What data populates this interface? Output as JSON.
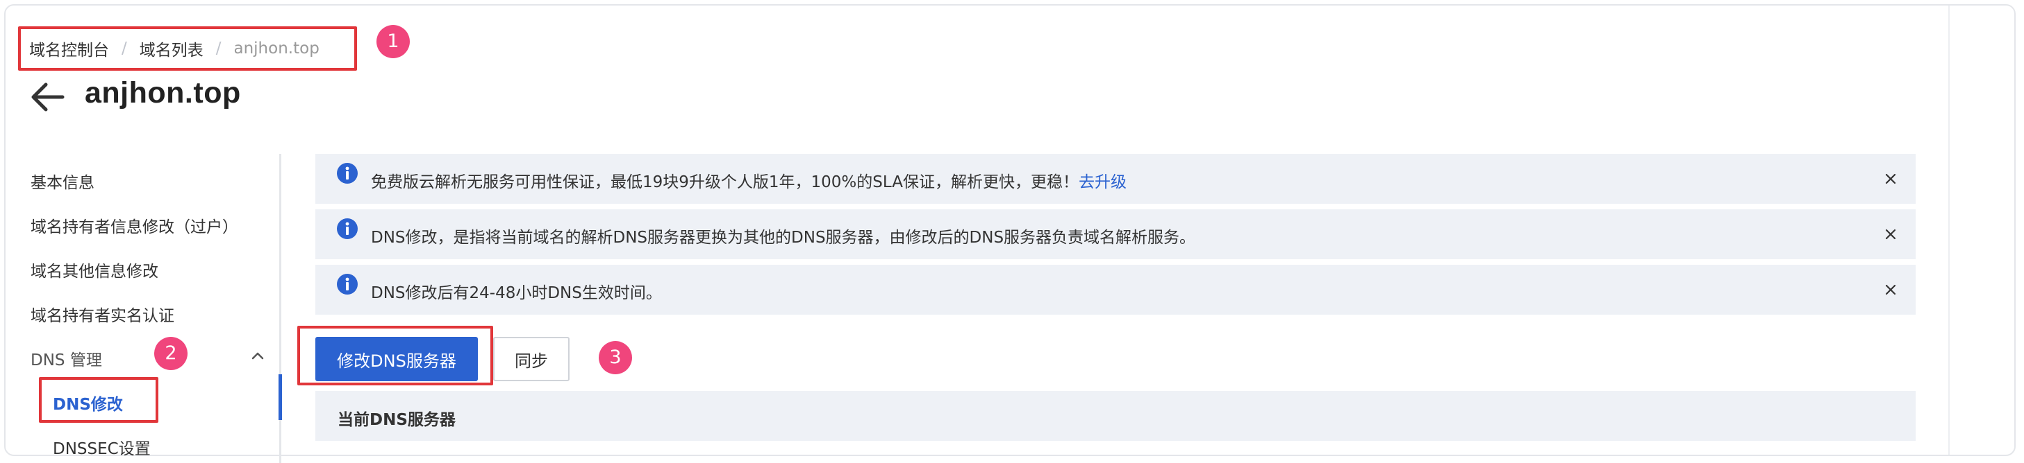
{
  "breadcrumb": {
    "items": [
      "域名控制台",
      "域名列表",
      "anjhon.top"
    ],
    "separator": "/"
  },
  "page": {
    "title": "anjhon.top",
    "back_icon": "arrow-left-icon"
  },
  "sidebar": {
    "items": [
      "基本信息",
      "域名持有者信息修改（过户）",
      "域名其他信息修改",
      "域名持有者实名认证"
    ],
    "group": {
      "label": "DNS 管理",
      "expanded": true,
      "children": [
        {
          "label": "DNS修改",
          "active": true
        },
        {
          "label": "DNSSEC设置",
          "active": false
        }
      ]
    }
  },
  "notices": [
    {
      "text": "免费版云解析无服务可用性保证，最低19块9升级个人版1年，100%的SLA保证，解析更快，更稳！",
      "link": "去升级"
    },
    {
      "text": "DNS修改，是指将当前域名的解析DNS服务器更换为其他的DNS服务器，由修改后的DNS服务器负责域名解析服务。",
      "link": ""
    },
    {
      "text": "DNS修改后有24-48小时DNS生效时间。",
      "link": ""
    }
  ],
  "actions": {
    "primary_label": "修改DNS服务器",
    "sync_label": "同步"
  },
  "table": {
    "header": "当前DNS服务器"
  },
  "annotations": [
    "1",
    "2",
    "3"
  ],
  "colors": {
    "accent": "#2b62d0",
    "notice_bg": "#eef1f6",
    "annotation_box": "#e1363a",
    "annotation_badge": "#f0457c"
  }
}
